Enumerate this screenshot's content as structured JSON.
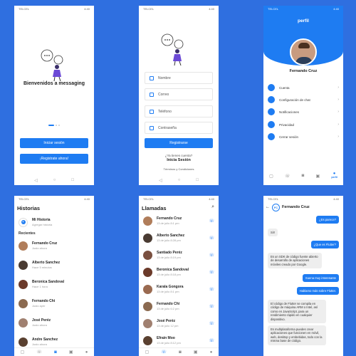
{
  "status": {
    "carrier": "TELCEL",
    "time": "4:40"
  },
  "welcome": {
    "title": "Bienvenidos a messaging",
    "login_button": "Iniciar sesión",
    "register_button": "¡Registrate ahora!"
  },
  "register": {
    "fields": [
      "Nombre",
      "Correo",
      "Teléfono",
      "Contraseña"
    ],
    "submit": "Registrarse",
    "have_account": "¿Ya tienes cuenta?",
    "login_link": "Inicia Sesión",
    "terms": "Términos y Condiciones"
  },
  "profile": {
    "title": "perfil",
    "name": "Fernando Cruz",
    "items": [
      "Cuenta",
      "Configuración de chat",
      "Notificaciones",
      "Privacidad",
      "Cerrar sesión"
    ],
    "tab_active": "perfil"
  },
  "stories": {
    "title": "Historias",
    "my_story": "Mi Historia",
    "my_story_sub": "Agregar historia",
    "recent": "Recientes",
    "items": [
      {
        "name": "Fernando Cruz",
        "sub": "Justo ahora"
      },
      {
        "name": "Alberto Sanchez",
        "sub": "Hace 5 minutos"
      },
      {
        "name": "Beronica Sandoval",
        "sub": "Hace 1 hora"
      },
      {
        "name": "Fernando Chi",
        "sub": "Justo ayer"
      },
      {
        "name": "José Peréz",
        "sub": "Justo ahora"
      },
      {
        "name": "Andre Sanchez",
        "sub": "Justo ahora"
      }
    ]
  },
  "calls": {
    "title": "Llamadas",
    "items": [
      {
        "name": "Fernando Cruz",
        "sub": "13 de julio 8:1 pm"
      },
      {
        "name": "Alberto Sanchez",
        "sub": "13 de julio 8:28 pm"
      },
      {
        "name": "Santiado Peréz",
        "sub": "13 de julio 8:19 pm"
      },
      {
        "name": "Beronica Sandoval",
        "sub": "13 de julio 8:18 pm"
      },
      {
        "name": "Karala Gongora",
        "sub": "13 de julio 8:1 pm"
      },
      {
        "name": "Fernando Chi",
        "sub": "13 de julio 6:2 pm"
      },
      {
        "name": "José Peréz",
        "sub": "13 de julio 12 pm"
      },
      {
        "name": "Efrain Moo",
        "sub": "13 de julio 8:12 pm"
      }
    ]
  },
  "chat": {
    "contact": "Fernando Cruz",
    "initials": "FC",
    "messages": [
      {
        "side": "r",
        "text": "¿Es parece?"
      },
      {
        "side": "l",
        "text": "Si!!"
      },
      {
        "side": "r",
        "text": "¿Que es Flutter?"
      },
      {
        "side": "l",
        "text": "Es un SDK de código fuente abierto de desarrollo de aplicaciones móviles creado por Google."
      },
      {
        "side": "r",
        "text": "Suena muy interesante"
      },
      {
        "side": "r",
        "text": "Hablamo más sobre Flutter."
      },
      {
        "side": "l",
        "text": "El código de Flutter se compila en código de máquina ARM o Intel, así como en JavaScript, para un rendimiento rápido en cualquier dispositivo."
      },
      {
        "side": "l",
        "text": "Es multiplataforma puedes crear aplicaciones que funcionen en móvil, web, desktop y embebidas, todo con la misma base de código."
      }
    ]
  }
}
